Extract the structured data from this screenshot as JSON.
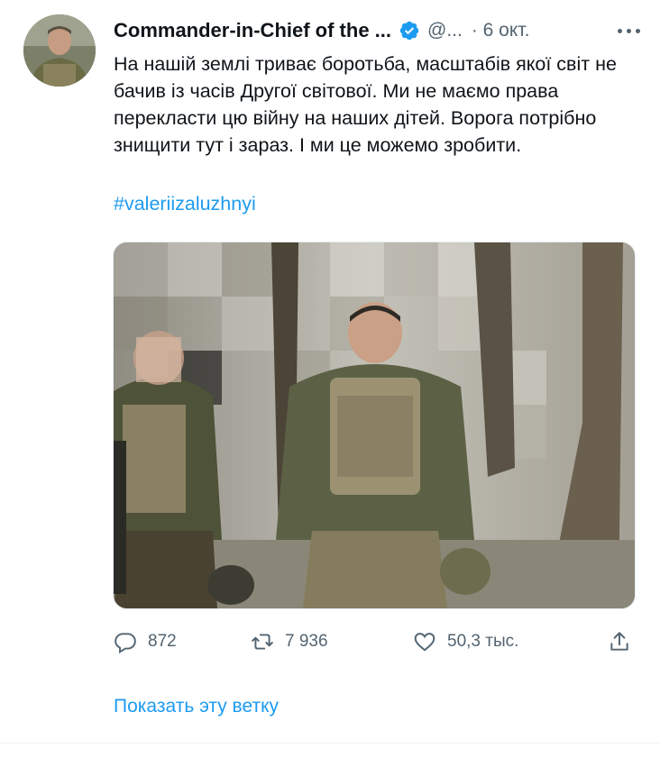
{
  "tweet": {
    "author_name": "Commander-in-Chief of the ...",
    "handle": "@...",
    "date": "· 6 окт.",
    "text": "На нашій землі триває боротьба, масштабів якої світ не бачив із часів Другої світової. Ми не маємо права перекласти цю війну на наших дітей. Ворога потрібно знищити тут і зараз. І ми це можемо зробити.",
    "hashtag": "#valeriizaluzhnyi",
    "media_icon": "photo-military-officers"
  },
  "actions": {
    "replies": "872",
    "retweets": "7 936",
    "likes": "50,3 тыс."
  },
  "thread_link": "Показать эту ветку",
  "colors": {
    "accent": "#1d9bf0",
    "text": "#0f1419",
    "secondary": "#536471"
  }
}
